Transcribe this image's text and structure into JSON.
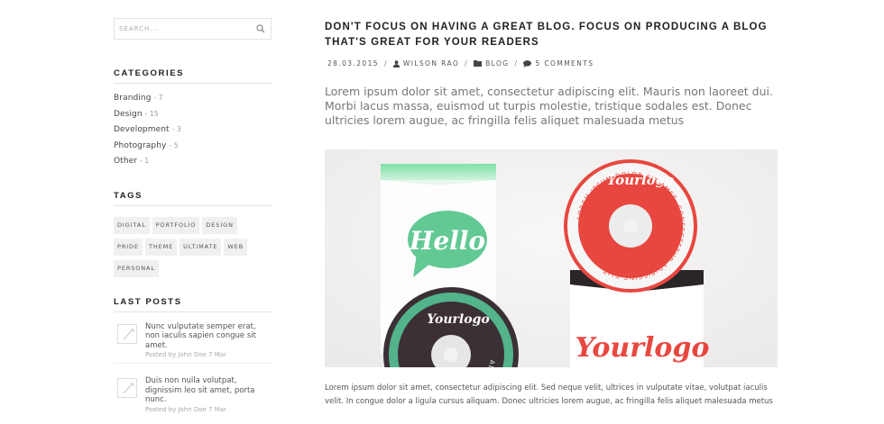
{
  "search": {
    "placeholder": "SEARCH..."
  },
  "categories": {
    "title": "CATEGORIES",
    "items": [
      {
        "label": "Branding",
        "count": "- 7"
      },
      {
        "label": "Design",
        "count": "- 15"
      },
      {
        "label": "Development",
        "count": "- 3"
      },
      {
        "label": "Photography",
        "count": "- 5"
      },
      {
        "label": "Other",
        "count": "- 1"
      }
    ]
  },
  "tags": {
    "title": "TAGS",
    "items": [
      "DIGITAL",
      "PORTFOLIO",
      "DESIGN",
      "PRIDE",
      "THEME",
      "ULTIMATE",
      "WEB",
      "PERSONAL"
    ]
  },
  "last_posts": {
    "title": "LAST POSTS",
    "items": [
      {
        "title": "Nunc vulputate semper erat, non iaculis sapien congue sit amet.",
        "meta": "Posted by John Doe 7 Mar"
      },
      {
        "title": "Duis non nulla volutpat, dignissim leo sit amet, porta nunc.",
        "meta": "Posted by John Doe 7 Mar"
      }
    ]
  },
  "post": {
    "title": "DON'T FOCUS ON HAVING A GREAT BLOG. FOCUS ON PRODUCING A BLOG THAT'S GREAT FOR YOUR READERS",
    "date": "28.03.2015",
    "author": "WILSON RAO",
    "category": "BLOG",
    "comments": "5 COMMENTS",
    "lead": "Lorem ipsum dolor sit amet, consectetur adipiscing elit. Mauris non laoreet dui. Morbi lacus massa, euismod ut turpis molestie, tristique sodales est. Donec ultricies lorem augue, ac fringilla felis aliquet malesuada metus",
    "body": "Lorem ipsum dolor sit amet, consectetur adipiscing elit. Sed neque velit, ultrices in vulputate vitae, volutpat iaculis velit. In congue dolor a ligula cursus aliquam. Donec ultricies lorem augue, ac fringilla felis aliquet malesuada metus"
  },
  "image": {
    "hello": "Hello",
    "logo": "Yourlogo",
    "disc_ring_text": "LOREM IPSUM DOLOR SIT AMET, CONSECTETUR ADIPISCING ELIT",
    "dark_ring_text": "ADIPISCING ELIT"
  },
  "colors": {
    "accent_red": "#e8473f",
    "accent_green": "#6fcf97",
    "dark_disc": "#3b3035"
  }
}
